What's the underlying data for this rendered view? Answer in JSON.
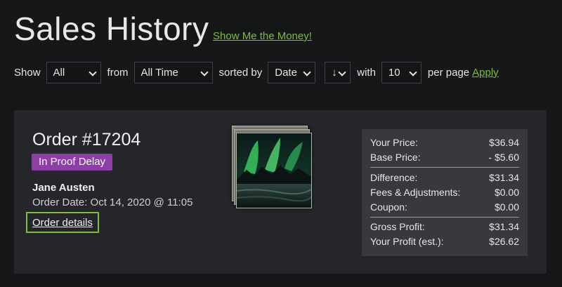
{
  "header": {
    "title": "Sales History",
    "money_link": "Show Me the Money!"
  },
  "filters": {
    "show_label": "Show",
    "show_value": "All",
    "from_label": "from",
    "from_value": "All Time",
    "sorted_label": "sorted by",
    "sort_value": "Date",
    "direction_value": "↓",
    "with_label": "with",
    "per_page_value": "10",
    "per_page_label": "per page",
    "apply_label": "Apply"
  },
  "order": {
    "title": "Order #17204",
    "status": "In Proof Delay",
    "customer": "Jane Austen",
    "date": "Order Date: Oct 14, 2020 @ 11:05",
    "details_label": "Order details"
  },
  "pricing": {
    "rows": [
      {
        "label": "Your Price:",
        "value": "$36.94"
      },
      {
        "label": "Base Price:",
        "value": "- $5.60"
      },
      {
        "label": "Difference:",
        "value": "$31.34"
      },
      {
        "label": "Fees & Adjustments:",
        "value": "$0.00"
      },
      {
        "label": "Coupon:",
        "value": "$0.00"
      },
      {
        "label": "Gross Profit:",
        "value": "$31.34"
      },
      {
        "label": "Your Profit (est.):",
        "value": "$26.62"
      }
    ]
  },
  "colors": {
    "accent": "#7cbf36",
    "status_badge": "#8e3fa6",
    "background": "#161719",
    "card": "#25262a"
  }
}
